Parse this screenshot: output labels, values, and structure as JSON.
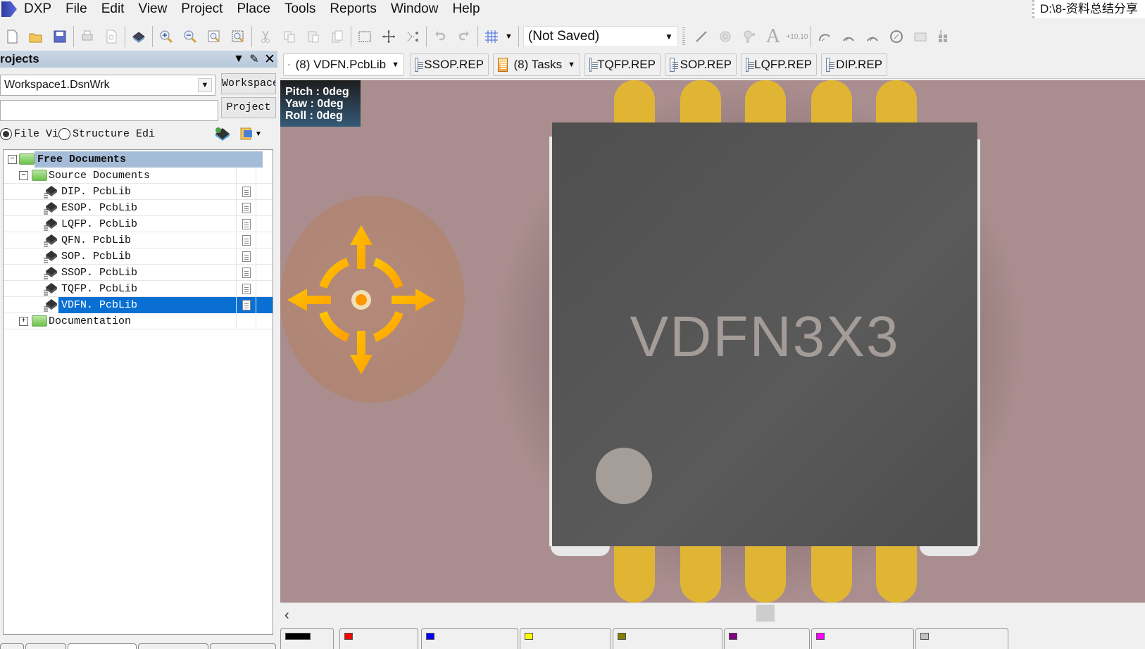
{
  "menubar": {
    "app": "DXP",
    "items": [
      "File",
      "Edit",
      "View",
      "Project",
      "Place",
      "Tools",
      "Reports",
      "Window",
      "Help"
    ],
    "path": "D:\\8-资料总结分享"
  },
  "toolbar": {
    "icons_left": [
      "new-document-icon",
      "open-folder-icon",
      "save-icon",
      "print-icon",
      "print-preview-icon",
      "3d-view-icon",
      "zoom-in-icon",
      "zoom-out-icon",
      "zoom-fit-icon",
      "zoom-selection-icon",
      "cut-icon",
      "copy-icon",
      "paste-icon",
      "rubber-stamp-icon",
      "select-area-icon",
      "move-icon",
      "deselect-icon",
      "undo-icon",
      "redo-icon",
      "grid-icon"
    ],
    "variant_combo": "(Not Saved)",
    "icons_right": [
      "line-icon",
      "pad-icon",
      "via-icon",
      "string-icon",
      "coordinate-icon",
      "arc-center-icon",
      "arc-edge-icon",
      "arc-any-icon",
      "full-circle-icon",
      "fill-icon",
      "array-paste-icon"
    ],
    "coordinate_label": "+10,10"
  },
  "projects_panel": {
    "title": "rojects",
    "workspace_value": "Workspace1.DsnWrk",
    "workspace_button": "Workspace",
    "project_value": "",
    "project_button": "Project",
    "radio_file_view": "File Vi",
    "radio_structure": "Structure Edi",
    "radio_selected": "file_view",
    "tree": {
      "root": "Free Documents",
      "group": "Source Documents",
      "files": [
        "DIP. PcbLib",
        "ESOP. PcbLib",
        "LQFP. PcbLib",
        "QFN. PcbLib",
        "SOP. PcbLib",
        "SSOP. PcbLib",
        "TQFP. PcbLib",
        "VDFN. PcbLib"
      ],
      "selected_file": "VDFN. PcbLib",
      "collapsed_group": "Documentation"
    }
  },
  "doc_tabs": [
    {
      "label": "(8) VDFN.PcbLib",
      "icon": "pcblib-icon",
      "dropdown": true,
      "active": true
    },
    {
      "label": "SSOP.REP",
      "icon": "report-icon",
      "dropdown": false
    },
    {
      "label": "(8) Tasks",
      "icon": "tasks-icon",
      "dropdown": true
    },
    {
      "label": "TQFP.REP",
      "icon": "report-icon",
      "dropdown": false
    },
    {
      "label": "SOP.REP",
      "icon": "report-icon",
      "dropdown": false
    },
    {
      "label": "LQFP.REP",
      "icon": "report-icon",
      "dropdown": false
    },
    {
      "label": "DIP.REP",
      "icon": "report-icon",
      "dropdown": false
    }
  ],
  "canvas": {
    "orientation": {
      "pitch": "Pitch : 0deg",
      "yaw": "Yaw : 0deg",
      "roll": "Roll : 0deg"
    },
    "component_label": "VDFN3X3",
    "colors": {
      "board": "#aa8e8f",
      "body": "#525252",
      "pad": "#e1b534",
      "label": "#a39c98",
      "navigator": "#ffb300"
    }
  },
  "layer_tabs": [
    {
      "color": "#000000",
      "label": ""
    },
    {
      "color": "#ff0000",
      "label": ""
    },
    {
      "color": "#0000ff",
      "label": ""
    },
    {
      "color": "#ffff00",
      "label": ""
    },
    {
      "color": "#808000",
      "label": ""
    },
    {
      "color": "#800080",
      "label": ""
    },
    {
      "color": "#ff00ff",
      "label": ""
    },
    {
      "color": "#c0c0c0",
      "label": ""
    }
  ]
}
